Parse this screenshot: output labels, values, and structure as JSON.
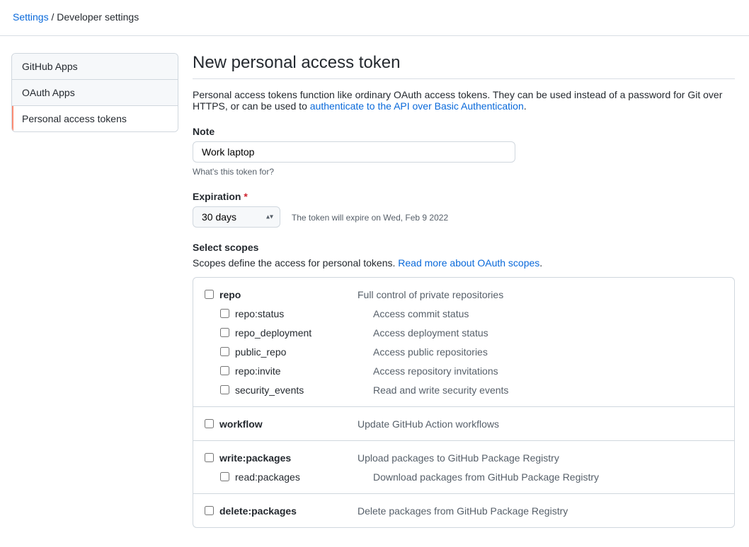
{
  "breadcrumb": {
    "settings": "Settings",
    "dev": "Developer settings"
  },
  "sidebar": {
    "items": [
      {
        "label": "GitHub Apps"
      },
      {
        "label": "OAuth Apps"
      },
      {
        "label": "Personal access tokens"
      }
    ]
  },
  "title": "New personal access token",
  "intro": {
    "pre": "Personal access tokens function like ordinary OAuth access tokens. They can be used instead of a password for Git over HTTPS, or can be used to ",
    "link": "authenticate to the API over Basic Authentication",
    "post": "."
  },
  "note": {
    "label": "Note",
    "value": "Work laptop",
    "hint": "What's this token for?"
  },
  "expiration": {
    "label": "Expiration",
    "required": "*",
    "value": "30 days",
    "note": "The token will expire on Wed, Feb 9 2022"
  },
  "scopes": {
    "heading": "Select scopes",
    "desc_pre": "Scopes define the access for personal tokens. ",
    "desc_link": "Read more about OAuth scopes",
    "desc_post": ".",
    "groups": [
      {
        "name": "repo",
        "desc": "Full control of private repositories",
        "children": [
          {
            "name": "repo:status",
            "desc": "Access commit status"
          },
          {
            "name": "repo_deployment",
            "desc": "Access deployment status"
          },
          {
            "name": "public_repo",
            "desc": "Access public repositories"
          },
          {
            "name": "repo:invite",
            "desc": "Access repository invitations"
          },
          {
            "name": "security_events",
            "desc": "Read and write security events"
          }
        ]
      },
      {
        "name": "workflow",
        "desc": "Update GitHub Action workflows",
        "children": []
      },
      {
        "name": "write:packages",
        "desc": "Upload packages to GitHub Package Registry",
        "children": [
          {
            "name": "read:packages",
            "desc": "Download packages from GitHub Package Registry"
          }
        ]
      },
      {
        "name": "delete:packages",
        "desc": "Delete packages from GitHub Package Registry",
        "children": []
      }
    ]
  }
}
